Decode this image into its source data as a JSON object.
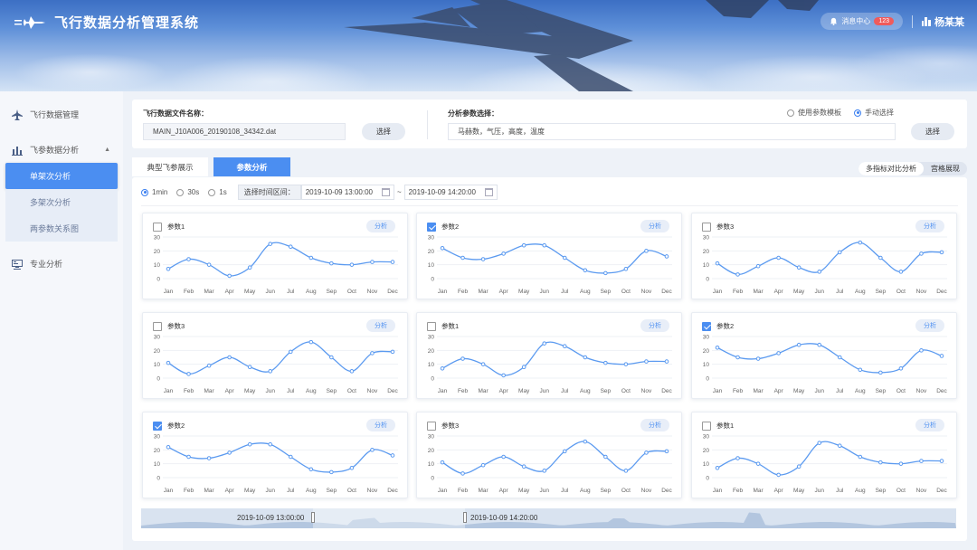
{
  "header": {
    "title": "飞行数据分析管理系统",
    "logo_icon": "jet-icon",
    "message_label": "消息中心",
    "message_count": "123",
    "user_name": "杨某某"
  },
  "sidebar": {
    "items": [
      {
        "label": "飞行数据管理",
        "icon": "plane-icon"
      },
      {
        "label": "飞参数据分析",
        "icon": "bar-chart-icon"
      },
      {
        "label": "专业分析",
        "icon": "monitor-icon"
      }
    ],
    "subitems": [
      "单架次分析",
      "多架次分析",
      "两参数关系图"
    ]
  },
  "file_select": {
    "label": "飞行数据文件名称：",
    "value": "MAIN_J10A006_20190108_34342.dat",
    "button": "选择"
  },
  "param_select": {
    "label": "分析参数选择：",
    "value": "马赫数，气压，高度，温度",
    "button": "选择",
    "mode_template": "使用参数模板",
    "mode_manual": "手动选择"
  },
  "tabs": [
    "典型飞参展示",
    "参数分析"
  ],
  "view_modes": [
    "多指标对比分析",
    "宫格展现"
  ],
  "time": {
    "intervals": [
      "1min",
      "30s",
      "1s"
    ],
    "range_label": "选择时间区间：",
    "start": "2019-10-09 13:00:00",
    "separator": "~",
    "end": "2019-10-09 14:20:00"
  },
  "chart_common": {
    "analyze_label": "分析",
    "months": [
      "Jan",
      "Feb",
      "Mar",
      "Apr",
      "May",
      "Jun",
      "Jul",
      "Aug",
      "Sep",
      "Oct",
      "Nov",
      "Dec"
    ],
    "y_ticks": [
      "30",
      "20",
      "10",
      "0"
    ],
    "ylim": [
      0,
      30
    ],
    "line_color": "#5b9af0"
  },
  "chart_data": [
    {
      "type": "line",
      "name": "参数1",
      "checked": false,
      "categories": [
        "Jan",
        "Feb",
        "Mar",
        "Apr",
        "May",
        "Jun",
        "Jul",
        "Aug",
        "Sep",
        "Oct",
        "Nov",
        "Dec"
      ],
      "values": [
        7,
        14,
        10,
        2,
        8,
        25,
        23,
        15,
        11,
        10,
        12,
        12
      ],
      "ylim": [
        0,
        30
      ]
    },
    {
      "type": "line",
      "name": "参数2",
      "checked": true,
      "categories": [
        "Jan",
        "Feb",
        "Mar",
        "Apr",
        "May",
        "Jun",
        "Jul",
        "Aug",
        "Sep",
        "Oct",
        "Nov",
        "Dec"
      ],
      "values": [
        22,
        15,
        14,
        18,
        24,
        24,
        15,
        6,
        4,
        7,
        20,
        16
      ],
      "ylim": [
        0,
        30
      ]
    },
    {
      "type": "line",
      "name": "参数3",
      "checked": false,
      "categories": [
        "Jan",
        "Feb",
        "Mar",
        "Apr",
        "May",
        "Jun",
        "Jul",
        "Aug",
        "Sep",
        "Oct",
        "Nov",
        "Dec"
      ],
      "values": [
        11,
        3,
        9,
        15,
        8,
        5,
        19,
        26,
        15,
        5,
        18,
        19
      ],
      "ylim": [
        0,
        30
      ]
    },
    {
      "type": "line",
      "name": "参数3",
      "checked": false,
      "categories": [
        "Jan",
        "Feb",
        "Mar",
        "Apr",
        "May",
        "Jun",
        "Jul",
        "Aug",
        "Sep",
        "Oct",
        "Nov",
        "Dec"
      ],
      "values": [
        11,
        3,
        9,
        15,
        8,
        5,
        19,
        26,
        15,
        5,
        18,
        19
      ],
      "ylim": [
        0,
        30
      ]
    },
    {
      "type": "line",
      "name": "参数1",
      "checked": false,
      "categories": [
        "Jan",
        "Feb",
        "Mar",
        "Apr",
        "May",
        "Jun",
        "Jul",
        "Aug",
        "Sep",
        "Oct",
        "Nov",
        "Dec"
      ],
      "values": [
        7,
        14,
        10,
        2,
        8,
        25,
        23,
        15,
        11,
        10,
        12,
        12
      ],
      "ylim": [
        0,
        30
      ]
    },
    {
      "type": "line",
      "name": "参数2",
      "checked": true,
      "categories": [
        "Jan",
        "Feb",
        "Mar",
        "Apr",
        "May",
        "Jun",
        "Jul",
        "Aug",
        "Sep",
        "Oct",
        "Nov",
        "Dec"
      ],
      "values": [
        22,
        15,
        14,
        18,
        24,
        24,
        15,
        6,
        4,
        7,
        20,
        16
      ],
      "ylim": [
        0,
        30
      ]
    },
    {
      "type": "line",
      "name": "参数2",
      "checked": true,
      "categories": [
        "Jan",
        "Feb",
        "Mar",
        "Apr",
        "May",
        "Jun",
        "Jul",
        "Aug",
        "Sep",
        "Oct",
        "Nov",
        "Dec"
      ],
      "values": [
        22,
        15,
        14,
        18,
        24,
        24,
        15,
        6,
        4,
        7,
        20,
        16
      ],
      "ylim": [
        0,
        30
      ]
    },
    {
      "type": "line",
      "name": "参数3",
      "checked": false,
      "categories": [
        "Jan",
        "Feb",
        "Mar",
        "Apr",
        "May",
        "Jun",
        "Jul",
        "Aug",
        "Sep",
        "Oct",
        "Nov",
        "Dec"
      ],
      "values": [
        11,
        3,
        9,
        15,
        8,
        5,
        19,
        26,
        15,
        5,
        18,
        19
      ],
      "ylim": [
        0,
        30
      ]
    },
    {
      "type": "line",
      "name": "参数1",
      "checked": false,
      "categories": [
        "Jan",
        "Feb",
        "Mar",
        "Apr",
        "May",
        "Jun",
        "Jul",
        "Aug",
        "Sep",
        "Oct",
        "Nov",
        "Dec"
      ],
      "values": [
        7,
        14,
        10,
        2,
        8,
        25,
        23,
        15,
        11,
        10,
        12,
        12
      ],
      "ylim": [
        0,
        30
      ]
    }
  ],
  "timeline": {
    "start_label": "2019-10-09 13:00:00",
    "end_label": "2019-10-09 14:20:00"
  }
}
